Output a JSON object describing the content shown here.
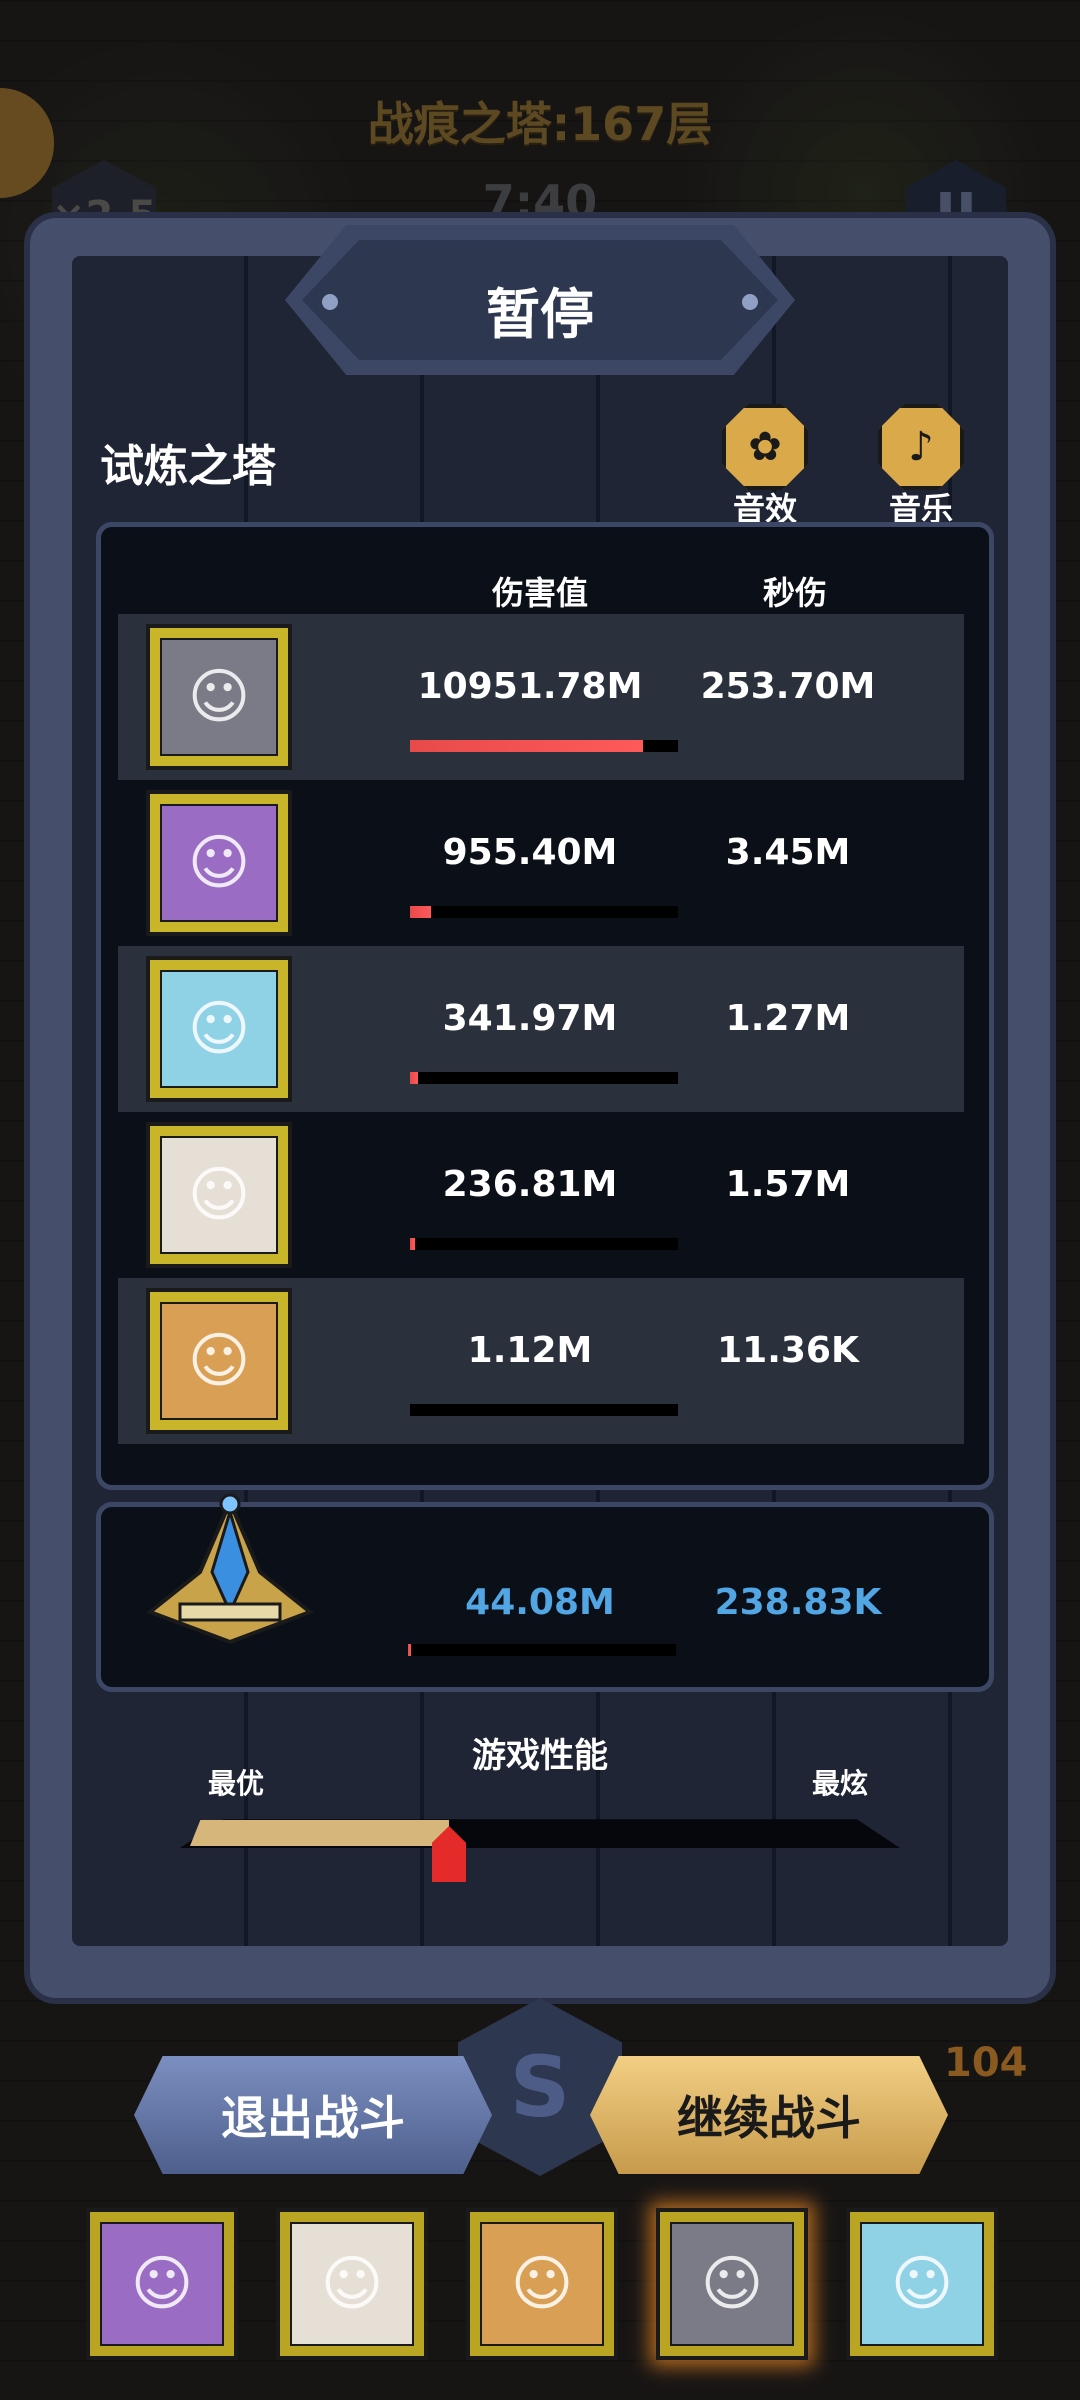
{
  "hud": {
    "floor_title": "战痕之塔:167层",
    "speed": "×2.5",
    "timer": "7:40",
    "pause_glyph": "II",
    "gold": "104"
  },
  "dialog": {
    "title": "暂停",
    "section_title": "试炼之塔",
    "sound_fx": {
      "label": "音效",
      "icon": "sound-effects-icon"
    },
    "music": {
      "label": "音乐",
      "icon": "music-icon"
    }
  },
  "stats": {
    "col_damage": "伤害值",
    "col_dps": "秒伤",
    "rows": [
      {
        "hero": "mushroom-hat-hero",
        "damage": "10951.78M",
        "dps": "253.70M",
        "share": 0.87,
        "tint": "#7a7b86"
      },
      {
        "hero": "purple-hair-heroine",
        "damage": "955.40M",
        "dps": "3.45M",
        "share": 0.08,
        "tint": "#9b6cc4"
      },
      {
        "hero": "white-mech-hero",
        "damage": "341.97M",
        "dps": "1.27M",
        "share": 0.03,
        "tint": "#8fd2e6"
      },
      {
        "hero": "white-hair-heroine",
        "damage": "236.81M",
        "dps": "1.57M",
        "share": 0.02,
        "tint": "#e6dfd6"
      },
      {
        "hero": "leopard-hero",
        "damage": "1.12M",
        "dps": "11.36K",
        "share": 0.0,
        "tint": "#d9a055"
      }
    ]
  },
  "artifact": {
    "damage": "44.08M",
    "dps": "238.83K",
    "share": 0.01
  },
  "performance": {
    "title": "游戏性能",
    "left_label": "最优",
    "right_label": "最炫",
    "level": 0.37
  },
  "buttons": {
    "exit": "退出战斗",
    "continue": "继续战斗"
  },
  "team": [
    {
      "hero": "purple-hair-heroine",
      "tint": "#9b6cc4"
    },
    {
      "hero": "white-hair-heroine",
      "tint": "#e6dfd6"
    },
    {
      "hero": "leopard-hero",
      "tint": "#d9a055"
    },
    {
      "hero": "mushroom-hat-hero",
      "tint": "#7a7b86",
      "active": true
    },
    {
      "hero": "white-mech-hero",
      "tint": "#8fd2e6"
    }
  ]
}
